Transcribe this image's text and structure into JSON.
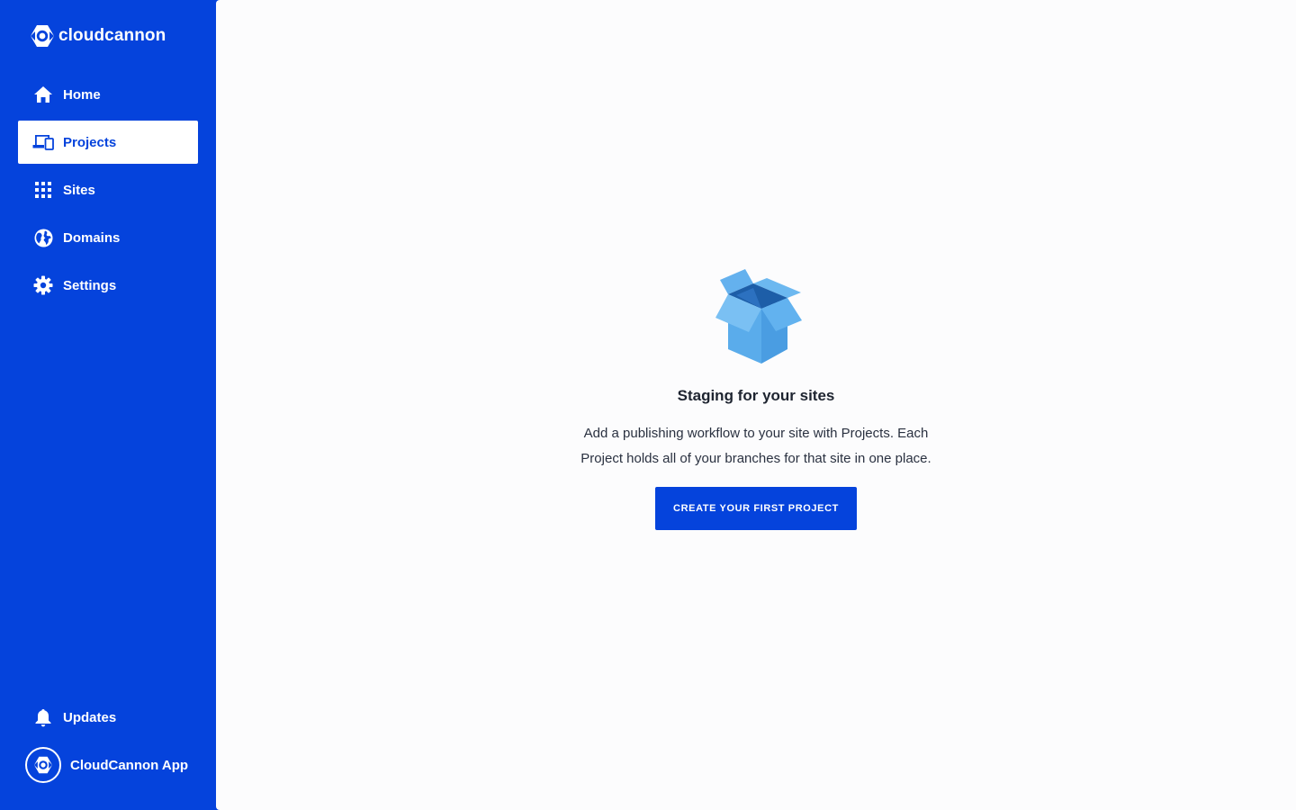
{
  "brand": {
    "name": "cloudcannon",
    "accent": "#0543dc"
  },
  "sidebar": {
    "items": [
      {
        "label": "Home",
        "icon": "home-icon",
        "active": false
      },
      {
        "label": "Projects",
        "icon": "devices-icon",
        "active": true
      },
      {
        "label": "Sites",
        "icon": "grid-icon",
        "active": false
      },
      {
        "label": "Domains",
        "icon": "globe-icon",
        "active": false
      },
      {
        "label": "Settings",
        "icon": "gear-icon",
        "active": false
      }
    ],
    "bottom": {
      "updates_label": "Updates",
      "updates_icon": "bell-icon",
      "app_label": "CloudCannon App",
      "app_icon": "cloudcannon-logo-icon"
    }
  },
  "main": {
    "empty_state": {
      "illustration": "open-box-illustration",
      "title": "Staging for your sites",
      "description": "Add a publishing workflow to your site with Projects. Each Project holds all of your branches for that site in one place.",
      "button_label": "CREATE YOUR FIRST PROJECT"
    }
  }
}
